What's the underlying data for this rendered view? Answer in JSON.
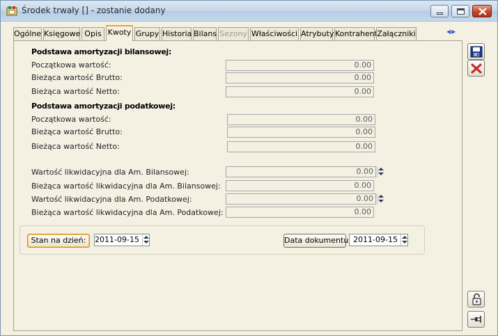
{
  "window": {
    "title": "Środek trwały [] - zostanie dodany"
  },
  "tabs": [
    {
      "label": "Ogólne",
      "state": "normal"
    },
    {
      "label": "Księgowe",
      "state": "normal"
    },
    {
      "label": "Opis",
      "state": "normal"
    },
    {
      "label": "Kwoty",
      "state": "active"
    },
    {
      "label": "Grupy",
      "state": "normal"
    },
    {
      "label": "Historia",
      "state": "normal"
    },
    {
      "label": "Bilans",
      "state": "normal"
    },
    {
      "label": "Sezony",
      "state": "disabled"
    },
    {
      "label": "Właściwości",
      "state": "normal"
    },
    {
      "label": "Atrybuty",
      "state": "normal"
    },
    {
      "label": "Kontrahent",
      "state": "normal"
    },
    {
      "label": "Załączniki",
      "state": "normal"
    }
  ],
  "bilansowa": {
    "header": "Podstawa amortyzacji bilansowej:",
    "rows": [
      {
        "label": "Początkowa wartość:",
        "value": "0.00"
      },
      {
        "label": "Bieżąca wartość Brutto:",
        "value": "0.00"
      },
      {
        "label": "Bieżąca wartość Netto:",
        "value": "0.00"
      }
    ]
  },
  "podatkowa": {
    "header": "Podstawa amortyzacji podatkowej:",
    "rows": [
      {
        "label": "Początkowa wartość:",
        "value": "0.00"
      },
      {
        "label": "Bieżąca wartość Brutto:",
        "value": "0.00"
      },
      {
        "label": "Bieżąca wartość Netto:",
        "value": "0.00"
      }
    ]
  },
  "likwidacyjna": {
    "rows": [
      {
        "label": "Wartość likwidacyjna dla Am. Bilansowej:",
        "value": "0.00"
      },
      {
        "label": "Bieżąca wartość likwidacyjna dla Am. Bilansowej:",
        "value": "0.00"
      },
      {
        "label": "Wartość likwidacyjna dla Am. Podatkowej:",
        "value": "0.00"
      },
      {
        "label": "Bieżąca wartość likwidacyjna dla Am. Podatkowej:",
        "value": "0.00"
      }
    ]
  },
  "dates": {
    "stan_label": "Stan na dzień:",
    "stan_value": "2011-09-15",
    "doc_label": "Data dokumentu:",
    "doc_value": "2011-09-15"
  },
  "icons": {
    "save": "floppy-disk-icon",
    "cancel": "red-x-icon",
    "unlock": "padlock-icon",
    "pin": "pushpin-icon"
  },
  "colors": {
    "background": "#f4f1e3",
    "active_tab_accent": "#f0a040",
    "cancel_red": "#d02020",
    "save_blue": "#1a3a8c"
  }
}
